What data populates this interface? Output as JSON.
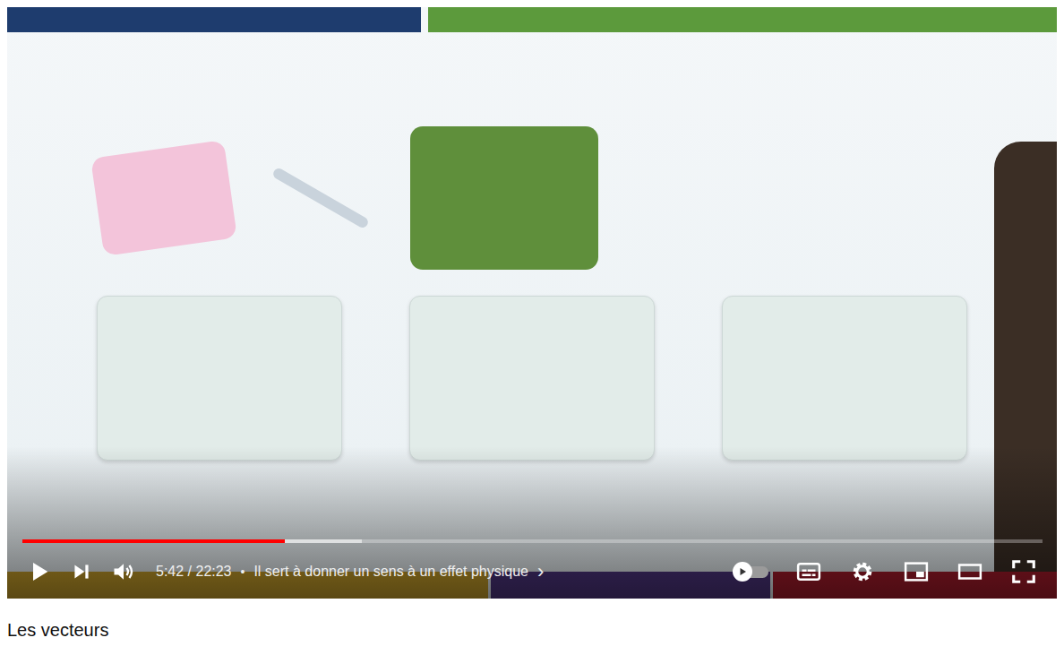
{
  "video": {
    "title": "Les vecteurs"
  },
  "player": {
    "playing": false,
    "muted": false,
    "time": "5:42 / 22:23",
    "separator": "•",
    "chapter": "Il sert à donner un sens à un effet physique",
    "chapter_chevron": "›",
    "progress": {
      "level": 0.257,
      "buffered": 0.333
    },
    "autoplay": {
      "on": false
    }
  }
}
